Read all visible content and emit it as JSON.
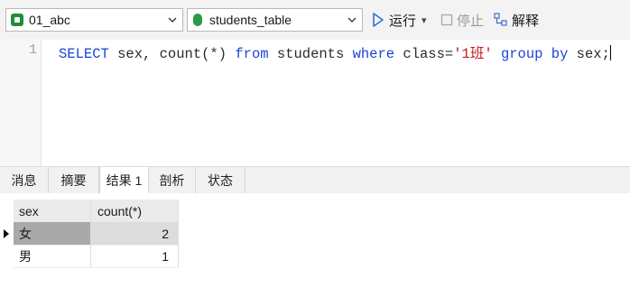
{
  "toolbar": {
    "connection": "01_abc",
    "table": "students_table",
    "run_label": "运行",
    "run_dropdown": "▾",
    "stop_label": "停止",
    "explain_label": "解释",
    "icons": [
      "connection-icon",
      "table-icon",
      "run-icon",
      "stop-icon",
      "explain-icon"
    ]
  },
  "editor": {
    "line_number": "1",
    "tokens": [
      {
        "t": "SELECT",
        "k": "kw"
      },
      {
        "t": " sex, count(*) ",
        "k": "plain"
      },
      {
        "t": "from",
        "k": "kw"
      },
      {
        "t": " students ",
        "k": "plain"
      },
      {
        "t": "where",
        "k": "kw"
      },
      {
        "t": " class=",
        "k": "plain"
      },
      {
        "t": "'1班'",
        "k": "str"
      },
      {
        "t": " ",
        "k": "plain"
      },
      {
        "t": "group",
        "k": "kw"
      },
      {
        "t": " ",
        "k": "plain"
      },
      {
        "t": "by",
        "k": "kw"
      },
      {
        "t": " sex;",
        "k": "plain"
      }
    ],
    "colors": {
      "keyword": "#1b44d6",
      "string": "#c41a1a"
    }
  },
  "tabs": [
    "消息",
    "摘要",
    "结果 1",
    "剖析",
    "状态"
  ],
  "active_tab": "结果 1",
  "result": {
    "columns": [
      "sex",
      "count(*)"
    ],
    "rows": [
      [
        "女",
        "2"
      ],
      [
        "男",
        "1"
      ]
    ],
    "selected_row": 0
  }
}
